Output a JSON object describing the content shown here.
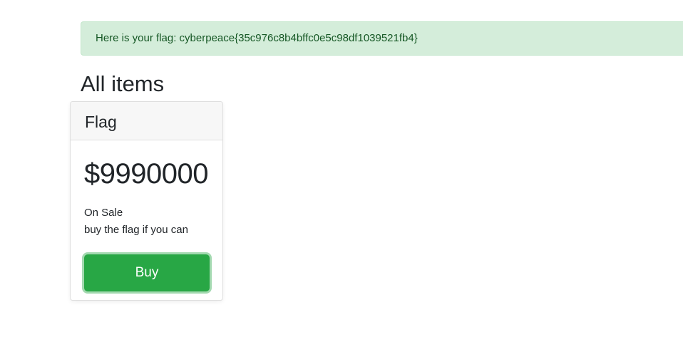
{
  "alert": {
    "text": "Here is your flag: cyberpeace{35c976c8b4bffc0e5c98df1039521fb4}"
  },
  "page": {
    "heading": "All items"
  },
  "item": {
    "name": "Flag",
    "price": "$9990000",
    "status": "On Sale",
    "description": "buy the flag if you can",
    "buy_label": "Buy"
  },
  "colors": {
    "alert_bg": "#d4edda",
    "alert_text": "#155724",
    "button_bg": "#28a745",
    "button_text": "#ffffff"
  }
}
